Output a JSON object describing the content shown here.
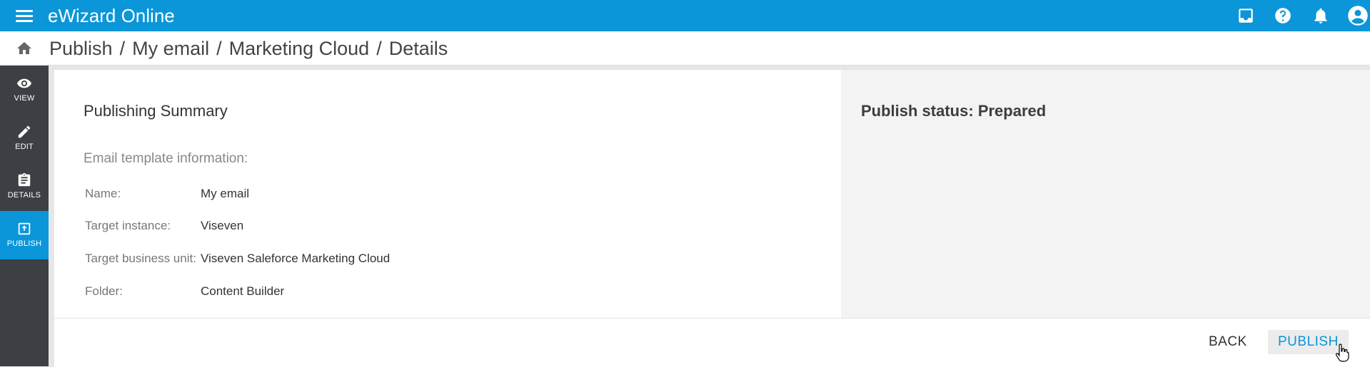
{
  "app": {
    "title": "eWizard Online"
  },
  "breadcrumb": [
    "Publish",
    "My email",
    "Marketing Cloud",
    "Details"
  ],
  "breadcrumb_separator": "/",
  "topbar": {
    "icons": [
      "inbox-icon",
      "help-icon",
      "bell-icon",
      "account-icon"
    ]
  },
  "sidebar": {
    "items": [
      {
        "label": "VIEW",
        "icon": "eye-icon",
        "active": false
      },
      {
        "label": "EDIT",
        "icon": "pencil-icon",
        "active": false
      },
      {
        "label": "DETAILS",
        "icon": "clipboard-icon",
        "active": false
      },
      {
        "label": "PUBLISH",
        "icon": "publish-icon",
        "active": true
      }
    ]
  },
  "summary": {
    "title": "Publishing Summary",
    "section_label": "Email template information:",
    "rows": [
      {
        "key": "Name:",
        "value": "My email"
      },
      {
        "key": "Target instance:",
        "value": "Viseven"
      },
      {
        "key": "Target business unit:",
        "value": "Viseven Saleforce Marketing Cloud"
      },
      {
        "key": "Folder:",
        "value": "Content Builder"
      }
    ]
  },
  "status": {
    "label": "Publish status:",
    "value": "Prepared"
  },
  "footer": {
    "back_label": "BACK",
    "publish_label": "PUBLISH"
  },
  "colors": {
    "accent": "#0a96d9",
    "sidebar": "#3c3f44",
    "pane": "#f3f3f3"
  }
}
